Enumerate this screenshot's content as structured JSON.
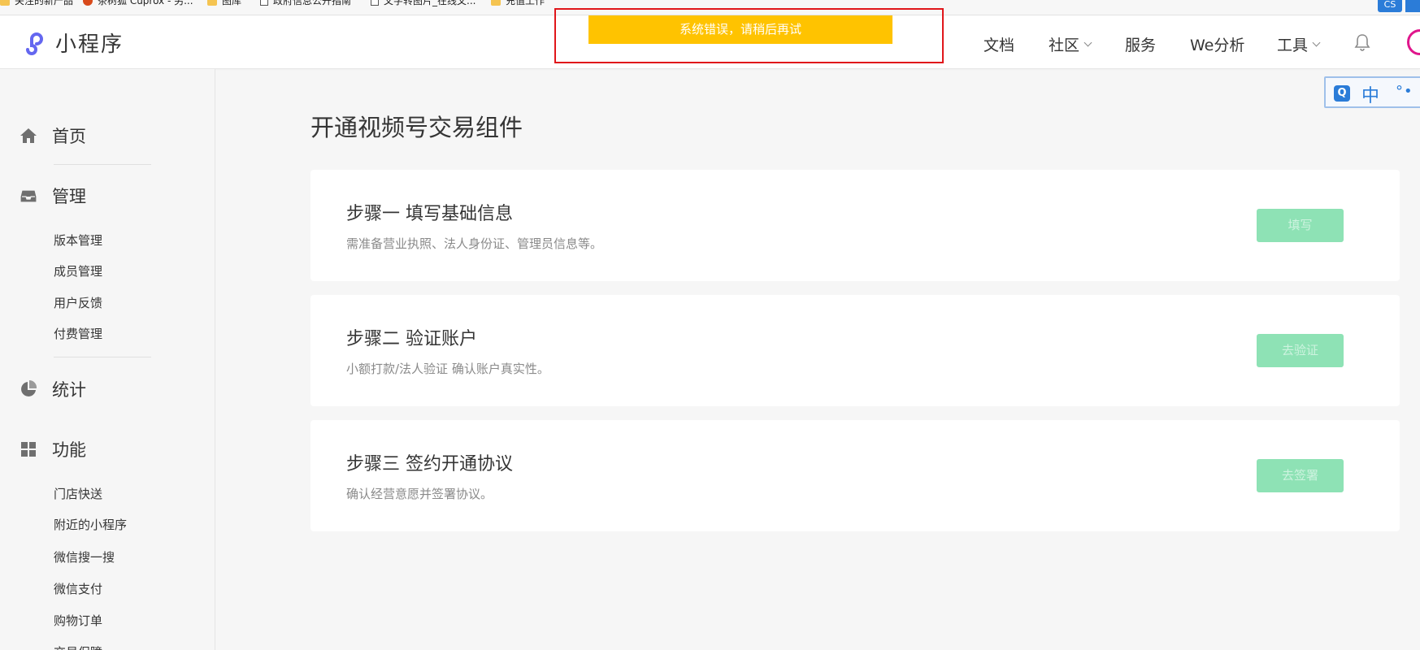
{
  "bookmarks": [
    {
      "label": "关注的新产品",
      "icon": "folder-icon"
    },
    {
      "label": "茶树狐 Cuprox - 另...",
      "icon": "firefox-icon"
    },
    {
      "label": "图库",
      "icon": "folder-icon"
    },
    {
      "label": "政府信息公开指南",
      "icon": "page-icon"
    },
    {
      "label": "文字转图片_在线文...",
      "icon": "page-icon"
    },
    {
      "label": "充值工作",
      "icon": "folder-icon"
    }
  ],
  "browser_ext_label": "CS",
  "header": {
    "logo_text": "小程序",
    "nav": [
      {
        "label": "文档",
        "has_dropdown": false
      },
      {
        "label": "社区",
        "has_dropdown": true
      },
      {
        "label": "服务",
        "has_dropdown": false
      },
      {
        "label": "We分析",
        "has_dropdown": false
      },
      {
        "label": "工具",
        "has_dropdown": true
      }
    ],
    "bell_icon": "bell-icon",
    "accent_color": "#6467f0"
  },
  "toast": {
    "message": "系统错误，请稍后再试",
    "color": "#ffc300",
    "highlight_border": "#e0161b"
  },
  "ime": {
    "q_label": "Q",
    "lang": "中",
    "extra": "°•"
  },
  "sidebar": {
    "sections": [
      {
        "label": "首页",
        "icon": "home-icon",
        "children": []
      },
      {
        "label": "管理",
        "icon": "inbox-icon",
        "children": [
          "版本管理",
          "成员管理",
          "用户反馈",
          "付费管理"
        ]
      },
      {
        "label": "统计",
        "icon": "pie-chart-icon",
        "children": []
      },
      {
        "label": "功能",
        "icon": "grid-icon",
        "children": [
          "门店快送",
          "附近的小程序",
          "微信搜一搜",
          "微信支付",
          "购物订单",
          "交易保障"
        ]
      }
    ]
  },
  "main": {
    "title": "开通视频号交易组件",
    "steps": [
      {
        "title": "步骤一 填写基础信息",
        "desc": "需准备营业执照、法人身份证、管理员信息等。",
        "button": "填写"
      },
      {
        "title": "步骤二 验证账户",
        "desc": "小额打款/法人验证 确认账户真实性。",
        "button": "去验证"
      },
      {
        "title": "步骤三 签约开通协议",
        "desc": "确认经营意愿并签署协议。",
        "button": "去签署"
      }
    ],
    "button_color": "#8ee2b5"
  }
}
